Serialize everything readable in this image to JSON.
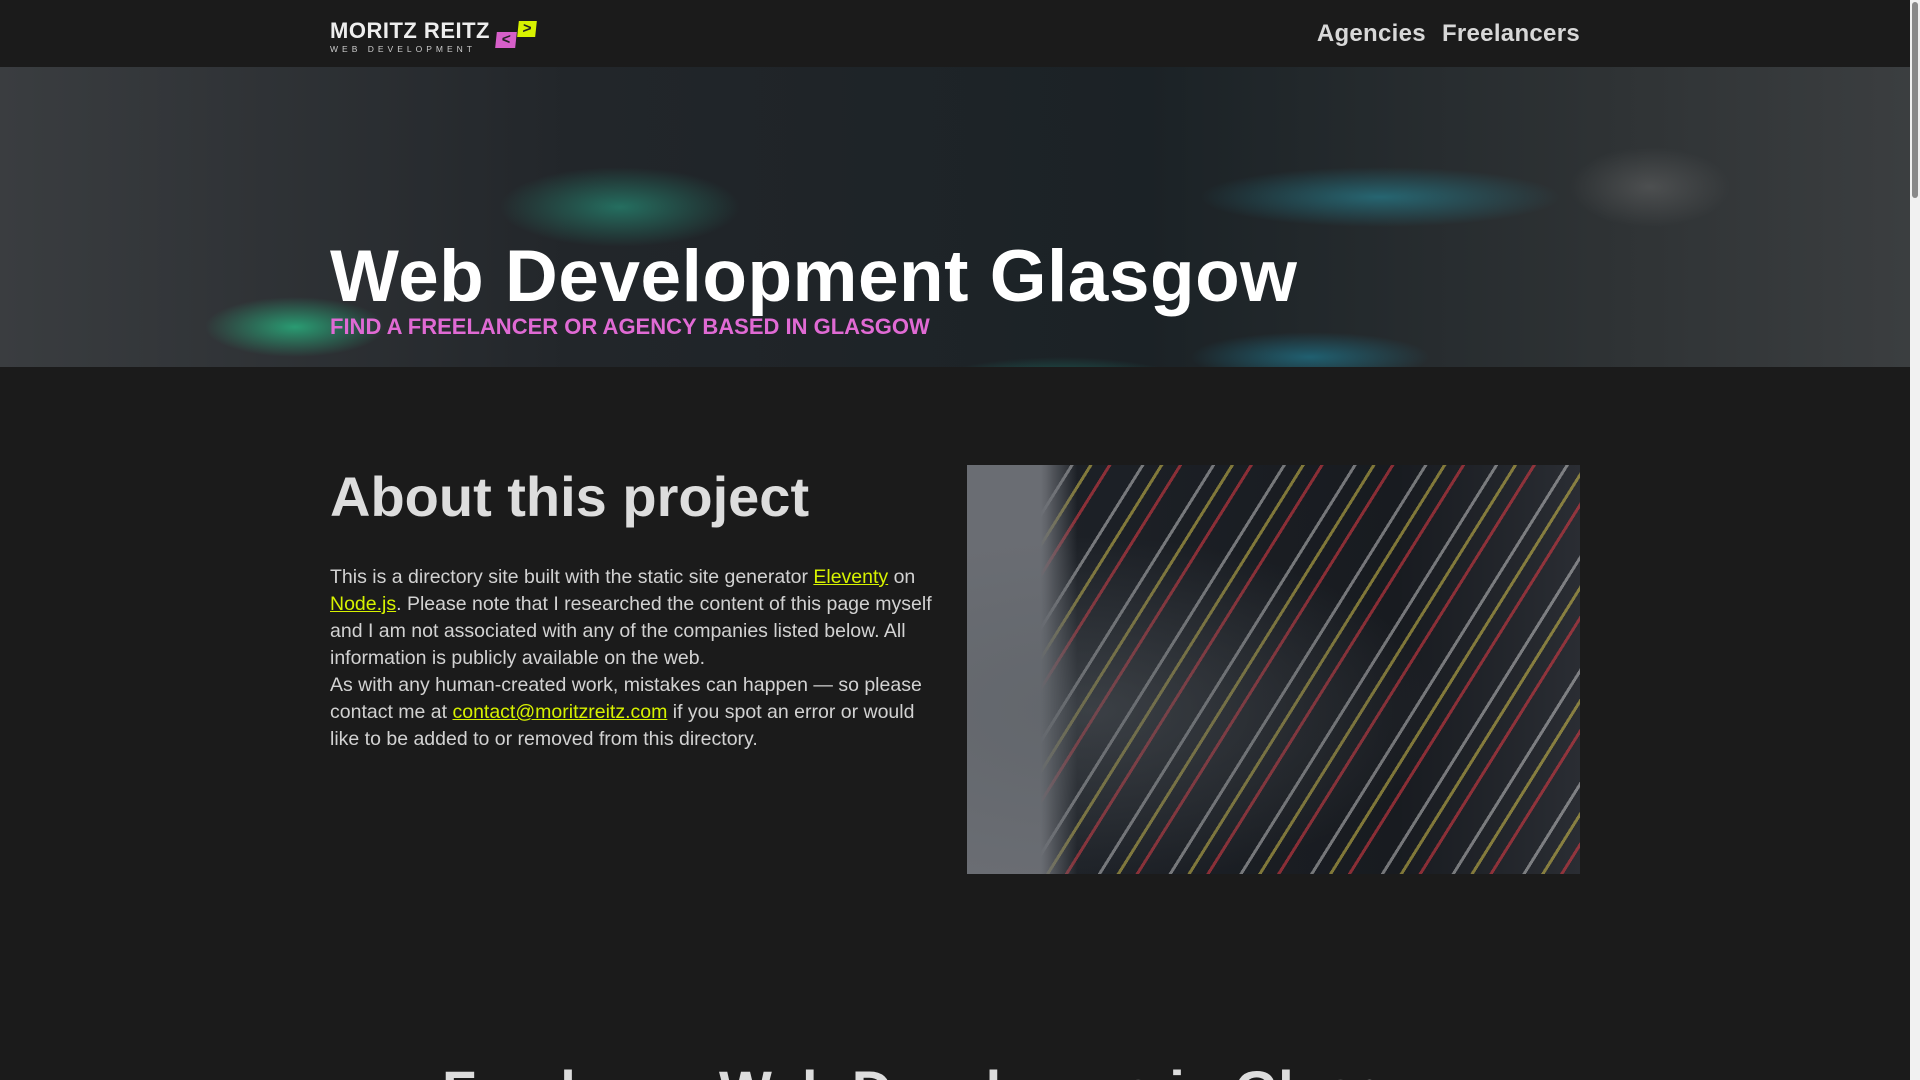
{
  "nav": {
    "logo_name": "MORITZ REITZ",
    "logo_sub": "WEB DEVELOPMENT",
    "logo_mark_left": "<",
    "logo_mark_right": ">",
    "links": [
      {
        "label": "Agencies"
      },
      {
        "label": "Freelancers"
      }
    ]
  },
  "hero": {
    "title": "Web Development Glasgow",
    "subtitle": "Find a freelancer or agency based in Glasgow"
  },
  "about": {
    "title": "About this project",
    "p1_a": "This is a directory site built with the static site generator ",
    "link_eleventy": "Eleventy",
    "p1_b": " on ",
    "link_node": "Node.js",
    "p1_c": ". Please note that I researched the content of this page myself and I am not associated with any of the companies listed below. All information is publicly available on the web.",
    "p2_a": "As with any human-created work, mistakes can happen — so please contact me at ",
    "link_email": "contact@moritzreitz.com",
    "p2_b": " if you spot an error or would like to be added to or removed from this directory."
  },
  "next_section": {
    "title": "Freelance Web Developers in Glasgow"
  },
  "colors": {
    "accent_green": "#d7f200",
    "accent_pink": "#e06ad4",
    "background": "#1b1b1b"
  }
}
